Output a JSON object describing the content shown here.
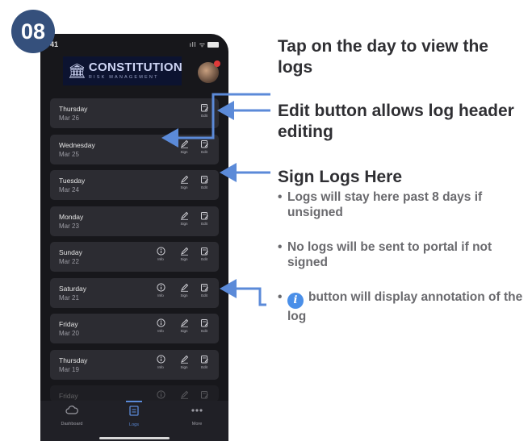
{
  "step_number": "08",
  "phone": {
    "status_time": "41",
    "status_icons": "ıll ᯤ",
    "logo": {
      "title": "CONSTITUTION",
      "subtitle": "RISK MANAGEMENT"
    },
    "logs": [
      {
        "day": "Thursday",
        "date": "Mar 26",
        "actions": [
          "Edit"
        ]
      },
      {
        "day": "Wednesday",
        "date": "Mar 25",
        "actions": [
          "Sign",
          "Edit"
        ]
      },
      {
        "day": "Tuesday",
        "date": "Mar 24",
        "actions": [
          "Sign",
          "Edit"
        ]
      },
      {
        "day": "Monday",
        "date": "Mar 23",
        "actions": [
          "Sign",
          "Edit"
        ]
      },
      {
        "day": "Sunday",
        "date": "Mar 22",
        "actions": [
          "Info",
          "Sign",
          "Edit"
        ]
      },
      {
        "day": "Saturday",
        "date": "Mar 21",
        "actions": [
          "Info",
          "Sign",
          "Edit"
        ]
      },
      {
        "day": "Friday",
        "date": "Mar 20",
        "actions": [
          "Info",
          "Sign",
          "Edit"
        ]
      },
      {
        "day": "Thursday",
        "date": "Mar 19",
        "actions": [
          "Info",
          "Sign",
          "Edit"
        ]
      },
      {
        "day": "Friday",
        "date": "",
        "actions": [
          "Info",
          "Sign",
          "Edit"
        ]
      }
    ],
    "tabs": [
      {
        "label": "Dashboard",
        "icon": "cloud-icon"
      },
      {
        "label": "Logs",
        "icon": "clipboard-icon",
        "active": true
      },
      {
        "label": "More",
        "icon": "more-dots-icon"
      }
    ]
  },
  "callouts": {
    "tap_day": "Tap on the day to view the logs",
    "edit_button": "Edit button allows log header editing",
    "sign_logs": "Sign Logs Here",
    "bullets": {
      "stay": "Logs will stay here past 8 days if unsigned",
      "not_sent": "No logs will be sent to portal if not signed",
      "info_button": "button will display annotation of the log"
    },
    "info_icon_glyph": "i"
  },
  "colors": {
    "badge": "#35507c",
    "arrow": "#5b8ad8",
    "card": "#2c2c32",
    "phone_bg": "#17171b"
  }
}
